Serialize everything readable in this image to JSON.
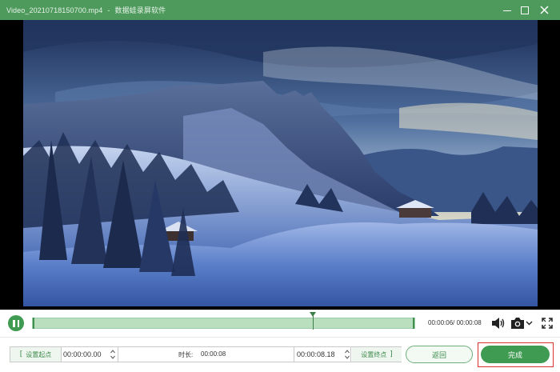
{
  "window": {
    "file_name": "Video_20210718150700.mp4",
    "separator": "-",
    "app_name": "数据蛙录屏软件",
    "minimize_icon": "minimize-icon",
    "maximize_icon": "maximize-icon",
    "close_icon": "close-icon",
    "accent_color": "#4e9a5d"
  },
  "player": {
    "preview_description": "snowy mountain landscape video frame",
    "pause_icon": "pause-icon",
    "current_time": "00:00:06",
    "total_time": "00:00:08",
    "time_separator": "/",
    "playhead_position": 0.73,
    "volume_icon": "volume-icon",
    "screenshot_icon": "camera-icon",
    "screenshot_menu_icon": "chevron-down-icon",
    "fullscreen_icon": "fullscreen-icon"
  },
  "trim": {
    "set_start_label": "设置起点",
    "start_value": "00:00:00.00",
    "duration_label": "时长:",
    "duration_value": "00:00:08",
    "end_value": "00:00:08.18",
    "set_end_label": "设置终点",
    "spinner_icon": "spinner-icon"
  },
  "actions": {
    "back_label": "返回",
    "done_label": "完成",
    "done_highlight_color": "#d9342b"
  }
}
